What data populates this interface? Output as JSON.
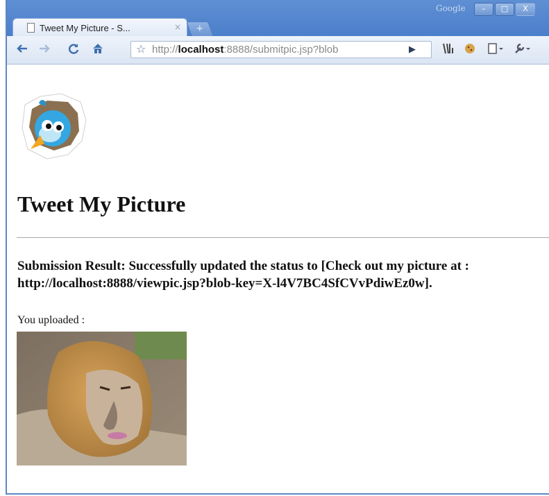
{
  "browser": {
    "corner_label": "Google",
    "window_controls": [
      "–",
      "□",
      "X"
    ],
    "tab": {
      "title": "Tweet My Picture - S...",
      "close": "×"
    },
    "new_tab": "+",
    "address": {
      "prefix": "http://",
      "host": "localhost",
      "rest": ":8888/submitpic.jsp?blob"
    },
    "colors": {
      "chrome_blue": "#5d87c4"
    }
  },
  "page": {
    "heading": "Tweet My Picture",
    "result": "Submission Result: Successfully updated the status to [Check out my picture at : http://localhost:8888/viewpic.jsp?blob-key=X-l4V7BC4SfCVvPdiwEz0w].",
    "uploaded_label": "You uploaded :"
  }
}
